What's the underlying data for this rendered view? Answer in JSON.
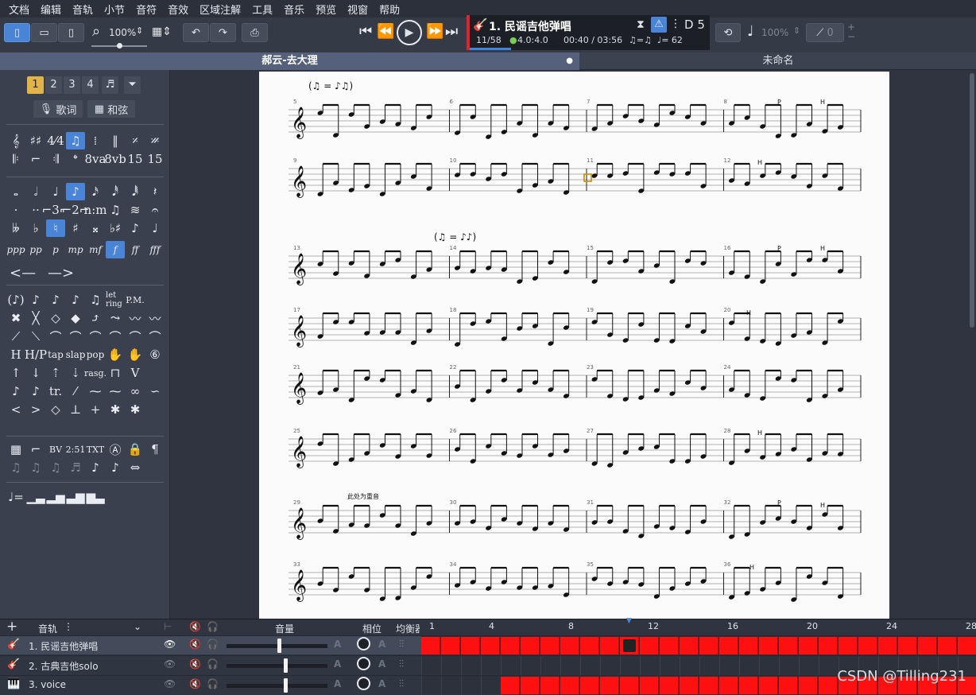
{
  "menu": [
    "文档",
    "编辑",
    "音轨",
    "小节",
    "音符",
    "音效",
    "区域注解",
    "工具",
    "音乐",
    "预览",
    "视窗",
    "帮助"
  ],
  "toolbar": {
    "zoom": "100%",
    "speed": "100%",
    "capo": "0",
    "key": "D 5"
  },
  "lcd": {
    "song": "1. 民谣吉他弹唱",
    "bar_position": "11/58",
    "signature": "4.0:4.0",
    "time": "00:40 / 03:56",
    "tempo": "♩= 62",
    "swing": "♫=♫"
  },
  "tabs": [
    {
      "label": "郝云-去大理",
      "active": true
    },
    {
      "label": "未命名",
      "active": false
    }
  ],
  "palette": {
    "voices": [
      "1",
      "2",
      "3",
      "4"
    ],
    "lyrics_label": "歌词",
    "chord_label": "和弦",
    "dynamics": [
      "ppp",
      "pp",
      "p",
      "mp",
      "mf",
      "f",
      "ff",
      "fff"
    ],
    "text_tools": [
      "BV",
      "2:51",
      "TXT"
    ],
    "effects_row": [
      "let ring",
      "P.M."
    ],
    "techniques": [
      "tap",
      "slap",
      "pop"
    ],
    "marks": [
      "rasg."
    ]
  },
  "score": {
    "tempo_mark_1": "(♫ = ♪♫)",
    "tempo_mark_2": "(♫ = ♪♪)",
    "annotation": "此处为重音",
    "rows": [
      {
        "measures": [
          "5",
          "6",
          "7",
          "8"
        ]
      },
      {
        "measures": [
          "9",
          "10",
          "11",
          "12"
        ]
      },
      {
        "measures": [
          "13",
          "14",
          "15",
          "16"
        ]
      },
      {
        "measures": [
          "17",
          "18",
          "19",
          "20"
        ]
      },
      {
        "measures": [
          "21",
          "22",
          "23",
          "24"
        ]
      },
      {
        "measures": [
          "25",
          "26",
          "27",
          "28"
        ]
      },
      {
        "measures": [
          "29",
          "30",
          "31",
          "32"
        ]
      },
      {
        "measures": [
          "33",
          "34",
          "35",
          "36"
        ]
      }
    ],
    "technique_marks": [
      "P",
      "H"
    ]
  },
  "tracks_header": {
    "add": "+",
    "label": "音轨",
    "volume": "音量",
    "pan": "相位",
    "balance": "均衡器"
  },
  "timeline": [
    "1",
    "4",
    "8",
    "12",
    "16",
    "20",
    "24",
    "28"
  ],
  "tracks": [
    {
      "name": "1. 民谣吉他弹唱",
      "selected": true,
      "volume": 0.52
    },
    {
      "name": "2. 古典吉他solo",
      "selected": false,
      "volume": 0.58
    },
    {
      "name": "3. voice",
      "selected": false,
      "volume": 0.58
    }
  ],
  "watermark": "CSDN @Tilling231",
  "colors": {
    "accent": "#4a84d6",
    "track_fill": "#ff1010",
    "lcd_red": "#e0242c"
  }
}
